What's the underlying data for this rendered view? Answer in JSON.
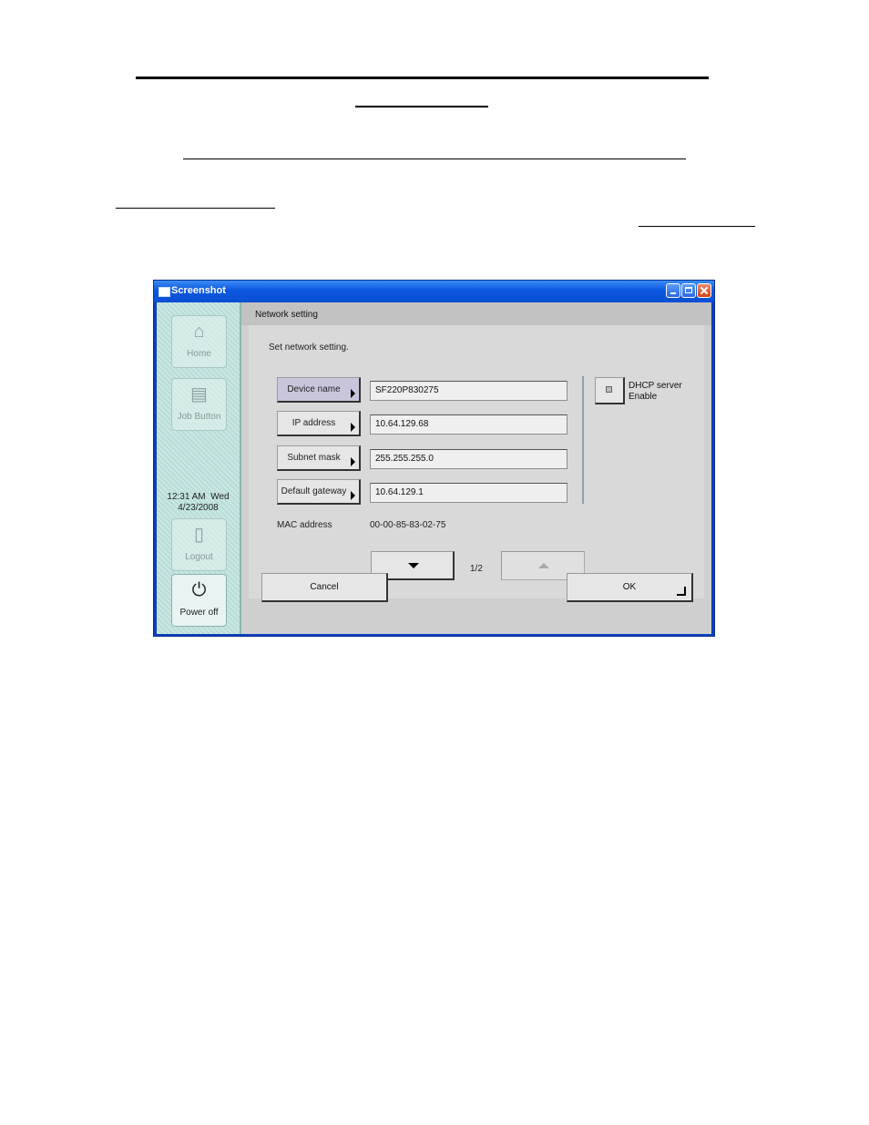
{
  "window": {
    "title": "Screenshot"
  },
  "sidebar": {
    "home_label": "Home",
    "job_button_label": "Job Button",
    "clock_time": "12:31 AM  Wed",
    "clock_date": "4/23/2008",
    "logout_label": "Logout",
    "power_off_label": "Power off"
  },
  "main": {
    "title": "Network setting",
    "prompt": "Set network setting.",
    "fields": [
      {
        "label": "Device name",
        "value": "SF220P830275"
      },
      {
        "label": "IP address",
        "value": "10.64.129.68"
      },
      {
        "label": "Subnet mask",
        "value": "255.255.255.0"
      },
      {
        "label": "Default gateway",
        "value": "10.64.129.1"
      }
    ],
    "mac_label": "MAC address",
    "mac_value": "00-00-85-83-02-75",
    "dhcp_line1": "DHCP server",
    "dhcp_line2": "Enable",
    "page_indicator": "1/2",
    "cancel_label": "Cancel",
    "ok_label": "OK"
  },
  "icons": [
    "home-icon",
    "job-button-icon",
    "logout-icon",
    "power-icon",
    "enter-icon"
  ]
}
